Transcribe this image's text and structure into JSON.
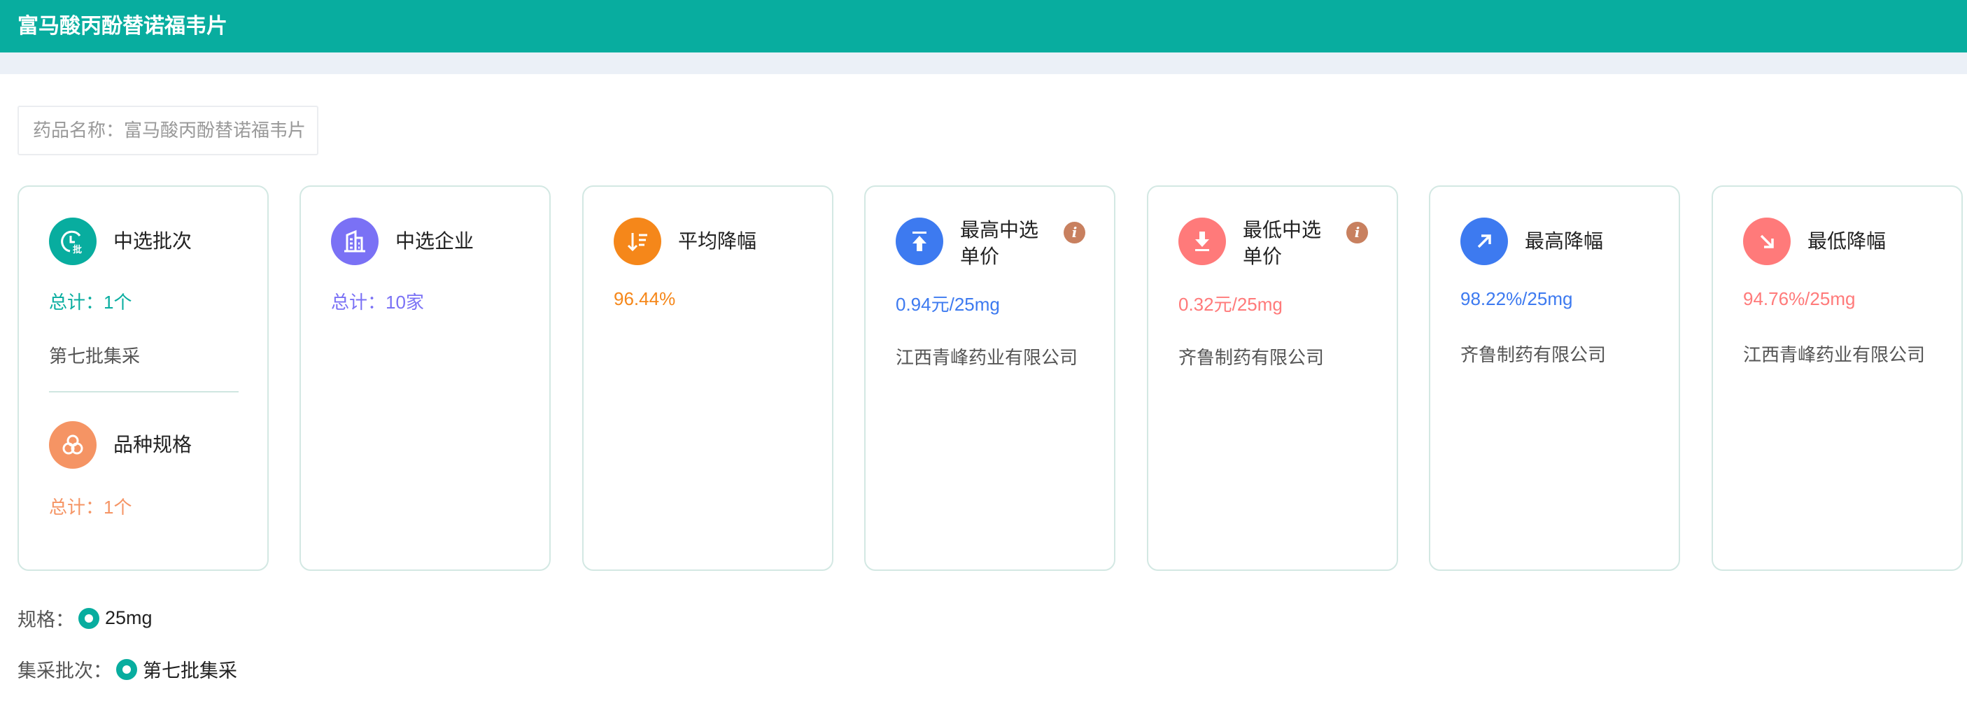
{
  "header": {
    "title": "富马酸丙酚替诺福韦片"
  },
  "search": {
    "text": "药品名称：富马酸丙酚替诺福韦片"
  },
  "cards": [
    {
      "title": "中选批次",
      "value": "总计：1个",
      "sub": "第七批集采",
      "icon": "batch-clock-icon",
      "color": "#08ad9f",
      "second": {
        "title": "品种规格",
        "value": "总计：1个",
        "icon": "variety-circles-icon",
        "color": "#f59464"
      }
    },
    {
      "title": "中选企业",
      "value": "总计：10家",
      "icon": "building-icon",
      "color": "#7a71f5"
    },
    {
      "title": "平均降幅",
      "value": "96.44%",
      "icon": "sort-down-icon",
      "color": "#f5871a"
    },
    {
      "title": "最高中选单价",
      "value": "0.94元/25mg",
      "sub": "江西青峰药业有限公司",
      "icon": "arrow-up-top-icon",
      "color": "#3d7af0"
    },
    {
      "title": "最低中选单价",
      "value": "0.32元/25mg",
      "sub": "齐鲁制药有限公司",
      "icon": "arrow-down-bottom-icon",
      "color": "#ff7a7a"
    },
    {
      "title": "最高降幅",
      "value": "98.22%/25mg",
      "sub": "齐鲁制药有限公司",
      "icon": "arrow-up-right-icon",
      "color": "#3d7af0"
    },
    {
      "title": "最低降幅",
      "value": "94.76%/25mg",
      "sub": "江西青峰药业有限公司",
      "icon": "arrow-down-right-icon",
      "color": "#ff7a7a"
    }
  ],
  "info_icon": "i",
  "filters": {
    "spec_label": "规格：",
    "spec_value": "25mg",
    "batch_label": "集采批次：",
    "batch_value": "第七批集采"
  }
}
